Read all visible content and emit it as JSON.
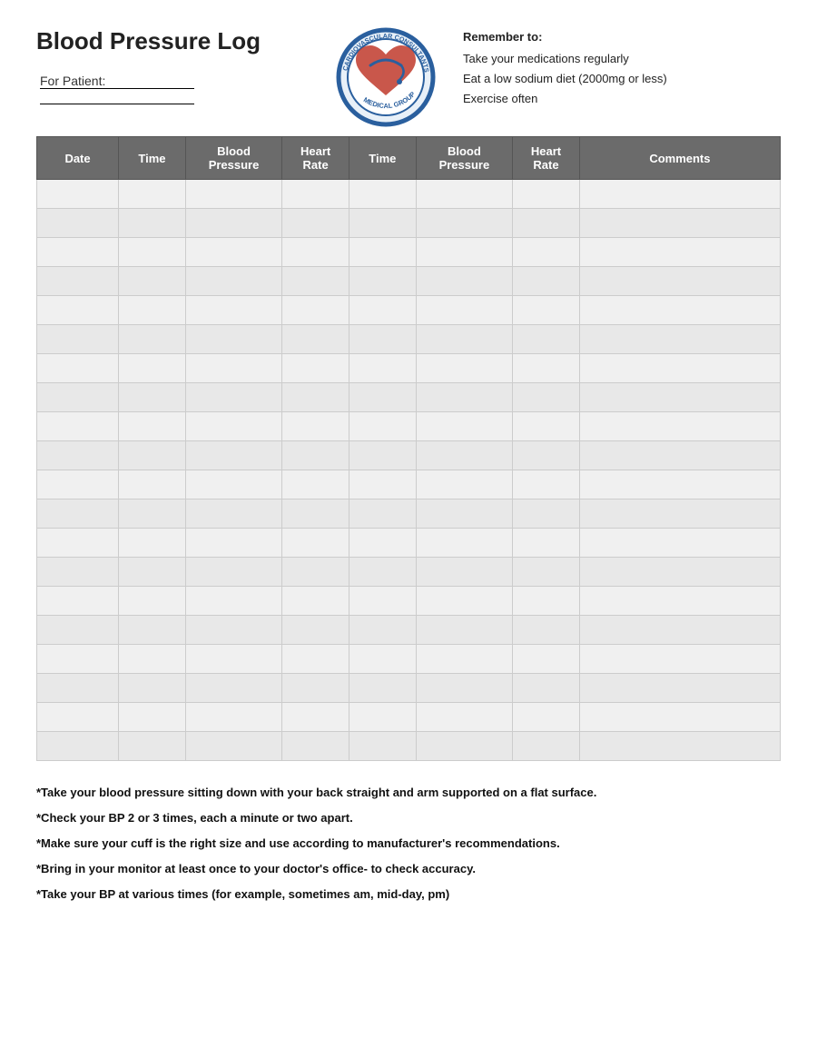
{
  "header": {
    "title": "Blood Pressure Log",
    "patient_label": "For Patient:",
    "remember_title": "Remember to:",
    "reminders": [
      "Take your medications regularly",
      "Eat a low sodium diet (2000mg or less)",
      "Exercise often"
    ]
  },
  "table": {
    "columns": [
      {
        "key": "date",
        "label": "Date"
      },
      {
        "key": "time1",
        "label": "Time"
      },
      {
        "key": "bp1",
        "label": "Blood\nPressure"
      },
      {
        "key": "hr1",
        "label": "Heart\nRate"
      },
      {
        "key": "time2",
        "label": "Time"
      },
      {
        "key": "bp2",
        "label": "Blood\nPressure"
      },
      {
        "key": "hr2",
        "label": "Heart\nRate"
      },
      {
        "key": "comments",
        "label": "Comments"
      }
    ],
    "row_count": 20
  },
  "footer": {
    "notes": [
      "*Take your blood pressure sitting down with your back straight and arm supported on a flat surface.",
      "*Check your BP 2 or 3 times, each a minute or two apart.",
      "*Make sure your cuff is the right size and use according to manufacturer's recommendations.",
      "*Bring in your monitor at least once to your doctor's office- to check accuracy.",
      "*Take your BP at various times (for example, sometimes am, mid-day, pm)"
    ]
  }
}
